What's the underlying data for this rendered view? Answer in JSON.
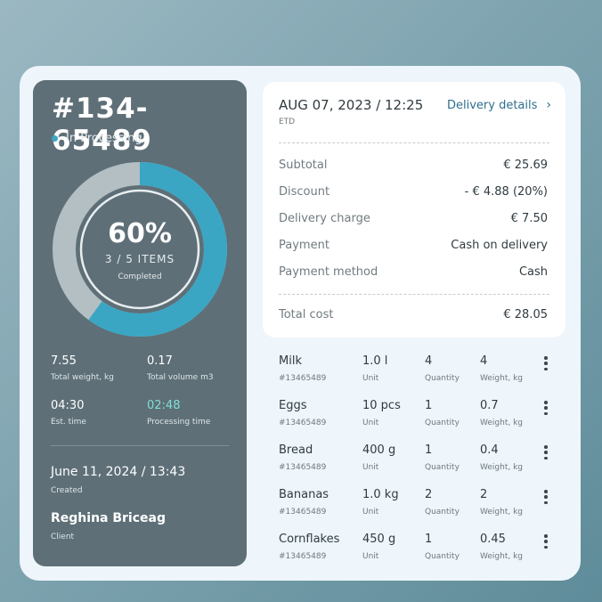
{
  "order": {
    "id": "#134-65489",
    "status": "In Processing",
    "progress": {
      "percent_label": "60%",
      "items_label": "3 / 5 ITEMS",
      "completed_label": "Completed",
      "fraction": 0.6
    },
    "stats": [
      {
        "value": "7.55",
        "label": "Total weight, kg"
      },
      {
        "value": "0.17",
        "label": "Total volume m3"
      },
      {
        "value": "04:30",
        "label": "Est. time"
      },
      {
        "value": "02:48",
        "label": "Processing time"
      }
    ],
    "created": {
      "value": "June 11, 2024  /  13:43",
      "label": "Created"
    },
    "client": {
      "value": "Reghina Briceag",
      "label": "Client"
    }
  },
  "summary": {
    "date": "AUG 07, 2023 / 12:25",
    "date_label": "ETD",
    "delivery_link": "Delivery details",
    "rows": [
      {
        "key": "Subtotal",
        "value": "€ 25.69"
      },
      {
        "key": "Discount",
        "value": "- € 4.88 (20%)"
      },
      {
        "key": "Delivery charge",
        "value": "€ 7.50"
      },
      {
        "key": "Payment",
        "value": "Cash on delivery"
      },
      {
        "key": "Payment method",
        "value": "Cash"
      }
    ],
    "total": {
      "key": "Total cost",
      "value": "€ 28.05"
    }
  },
  "items": [
    {
      "name": "Milk",
      "code": "#13465489",
      "unit": "1.0 l",
      "unit_label": "Unit",
      "qty": "4",
      "qty_label": "Quantity",
      "weight": "4",
      "weight_label": "Weight, kg"
    },
    {
      "name": "Eggs",
      "code": "#13465489",
      "unit": "10 pcs",
      "unit_label": "Unit",
      "qty": "1",
      "qty_label": "Quantity",
      "weight": "0.7",
      "weight_label": "Weight, kg"
    },
    {
      "name": "Bread",
      "code": "#13465489",
      "unit": "400 g",
      "unit_label": "Unit",
      "qty": "1",
      "qty_label": "Quantity",
      "weight": "0.4",
      "weight_label": "Weight, kg"
    },
    {
      "name": "Bananas",
      "code": "#13465489",
      "unit": "1.0 kg",
      "unit_label": "Unit",
      "qty": "2",
      "qty_label": "Quantity",
      "weight": "2",
      "weight_label": "Weight, kg"
    },
    {
      "name": "Cornflakes",
      "code": "#13465489",
      "unit": "450 g",
      "unit_label": "Unit",
      "qty": "1",
      "qty_label": "Quantity",
      "weight": "0.45",
      "weight_label": "Weight, kg"
    }
  ],
  "colors": {
    "accent": "#3aa6c4",
    "panel": "#5e6f77",
    "highlight": "#7ee0d6"
  }
}
